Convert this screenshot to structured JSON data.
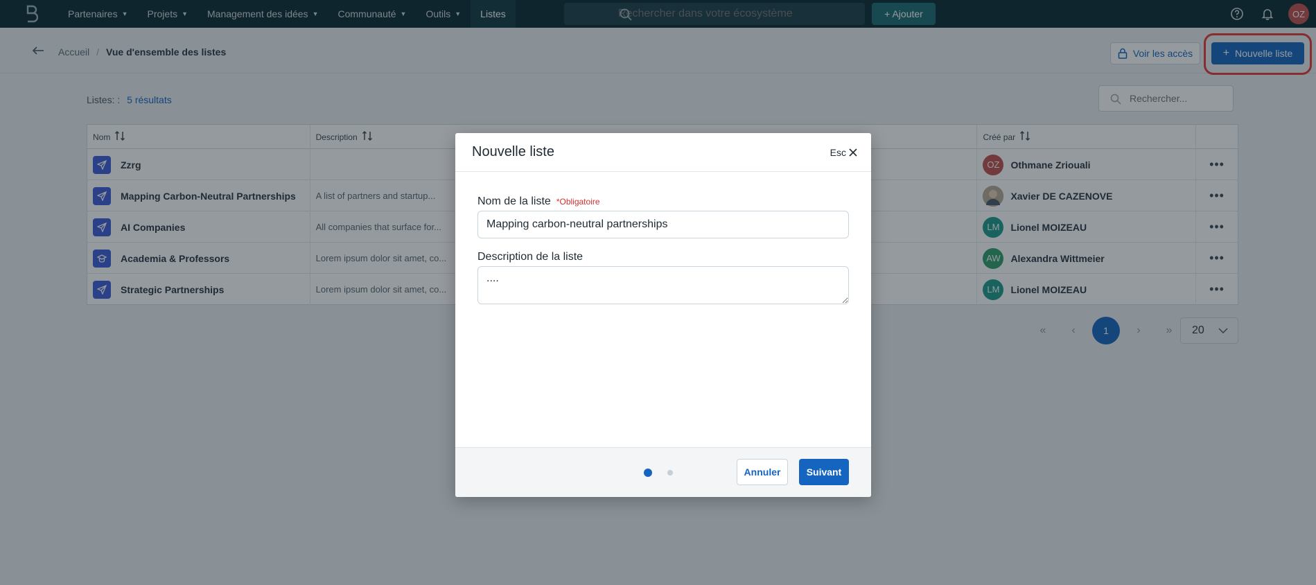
{
  "nav": {
    "items": [
      {
        "label": "Partenaires",
        "has_caret": true
      },
      {
        "label": "Projets",
        "has_caret": true
      },
      {
        "label": "Management des idées",
        "has_caret": true
      },
      {
        "label": "Communauté",
        "has_caret": true
      },
      {
        "label": "Outils",
        "has_caret": true
      },
      {
        "label": "Listes",
        "has_caret": false
      }
    ],
    "search_placeholder": "Rechercher dans votre écosystème",
    "add_label": "+ Ajouter",
    "user_initials": "OZ"
  },
  "breadcrumb": {
    "home": "Accueil",
    "separator": "/",
    "current": "Vue d'ensemble des listes"
  },
  "actions": {
    "access_label": "Voir les accès",
    "new_list_label": "Nouvelle liste"
  },
  "results": {
    "label": "Listes: :",
    "count": "5 résultats"
  },
  "content_search_placeholder": "Rechercher...",
  "table": {
    "headers": {
      "name": "Nom",
      "description": "Description",
      "creator": "Créé par"
    },
    "rows": [
      {
        "name": "Zzrg",
        "description": "",
        "creator": "Othmane Zriouali",
        "initials": "OZ",
        "avatar_color": "#c0504d"
      },
      {
        "name": "Mapping Carbon-Neutral Partnerships",
        "description": "A list of partners and startup...",
        "creator": "Xavier DE CAZENOVE",
        "initials": "",
        "avatar_color": "#8d7b6a"
      },
      {
        "name": "AI Companies",
        "description": "All companies that surface for...",
        "creator": "Lionel MOIZEAU",
        "initials": "LM",
        "avatar_color": "#1e9b8a"
      },
      {
        "name": "Academia & Professors",
        "description": "Lorem ipsum dolor sit amet, co...",
        "creator": "Alexandra Wittmeier",
        "initials": "AW",
        "avatar_color": "#2f9e6b"
      },
      {
        "name": "Strategic Partnerships",
        "description": "Lorem ipsum dolor sit amet, co...",
        "creator": "Lionel MOIZEAU",
        "initials": "LM",
        "avatar_color": "#1e9b8a"
      }
    ]
  },
  "pagination": {
    "current_page": "1",
    "page_size": "20"
  },
  "modal": {
    "title": "Nouvelle liste",
    "close_label": "Esc",
    "name_label": "Nom de la liste",
    "required_label": "*Obligatoire",
    "name_value": "Mapping carbon-neutral partnerships",
    "description_label": "Description de la liste",
    "description_value": "....",
    "cancel_label": "Annuler",
    "next_label": "Suivant"
  },
  "colors": {
    "nav_bg": "#0b2a33",
    "primary": "#1565c0",
    "highlight": "#e53935",
    "list_icon": "#3d5bd9"
  }
}
